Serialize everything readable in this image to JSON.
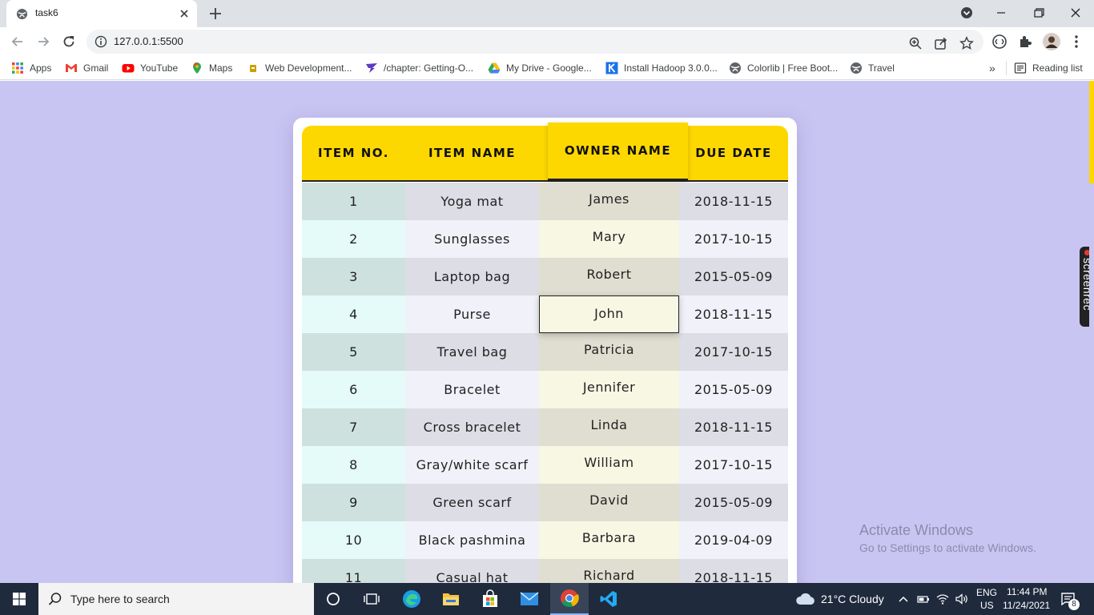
{
  "browser": {
    "tab_title": "task6",
    "url": "127.0.0.1:5500",
    "bookmarks": [
      {
        "label": "Apps",
        "icon": "apps-grid-icon"
      },
      {
        "label": "Gmail",
        "icon": "gmail-icon"
      },
      {
        "label": "YouTube",
        "icon": "youtube-icon"
      },
      {
        "label": "Maps",
        "icon": "maps-icon"
      },
      {
        "label": "Web Development...",
        "icon": "bookmark-folder-icon"
      },
      {
        "label": "/chapter: Getting-O...",
        "icon": "feather-icon"
      },
      {
        "label": "My Drive - Google...",
        "icon": "google-drive-icon"
      },
      {
        "label": "Install Hadoop 3.0.0...",
        "icon": "k-icon"
      },
      {
        "label": "Colorlib | Free Boot...",
        "icon": "globe-icon"
      },
      {
        "label": "Travel",
        "icon": "globe-icon"
      }
    ],
    "overflow_label": "»",
    "reading_list": "Reading list"
  },
  "table": {
    "headers": {
      "item_no": "ITEM NO.",
      "item_name": "ITEM NAME",
      "owner_name": "OWNER NAME",
      "due_date": "DUE DATE"
    },
    "rows": [
      {
        "no": "1",
        "name": "Yoga mat",
        "owner": "James",
        "due": "2018-11-15"
      },
      {
        "no": "2",
        "name": "Sunglasses",
        "owner": "Mary",
        "due": "2017-10-15"
      },
      {
        "no": "3",
        "name": "Laptop bag",
        "owner": "Robert",
        "due": "2015-05-09"
      },
      {
        "no": "4",
        "name": "Purse",
        "owner": "John",
        "due": "2018-11-15"
      },
      {
        "no": "5",
        "name": "Travel bag",
        "owner": "Patricia",
        "due": "2017-10-15"
      },
      {
        "no": "6",
        "name": "Bracelet",
        "owner": "Jennifer",
        "due": "2015-05-09"
      },
      {
        "no": "7",
        "name": "Cross bracelet",
        "owner": "Linda",
        "due": "2018-11-15"
      },
      {
        "no": "8",
        "name": "Gray/white scarf",
        "owner": "William",
        "due": "2017-10-15"
      },
      {
        "no": "9",
        "name": "Green scarf",
        "owner": "David",
        "due": "2015-05-09"
      },
      {
        "no": "10",
        "name": "Black pashmina",
        "owner": "Barbara",
        "due": "2019-04-09"
      },
      {
        "no": "11",
        "name": "Casual hat",
        "owner": "Richard",
        "due": "2018-11-15"
      }
    ]
  },
  "overlay": {
    "activate_title": "Activate Windows",
    "activate_sub": "Go to Settings to activate Windows.",
    "screenrec": "screenrec"
  },
  "taskbar": {
    "search_placeholder": "Type here to search",
    "weather": "21°C  Cloudy",
    "lang_top": "ENG",
    "lang_bottom": "US",
    "time": "11:44 PM",
    "date": "11/24/2021",
    "notification_count": "8"
  },
  "colors": {
    "page_bg": "#c9c5f2",
    "header_yellow": "#fdd800"
  }
}
